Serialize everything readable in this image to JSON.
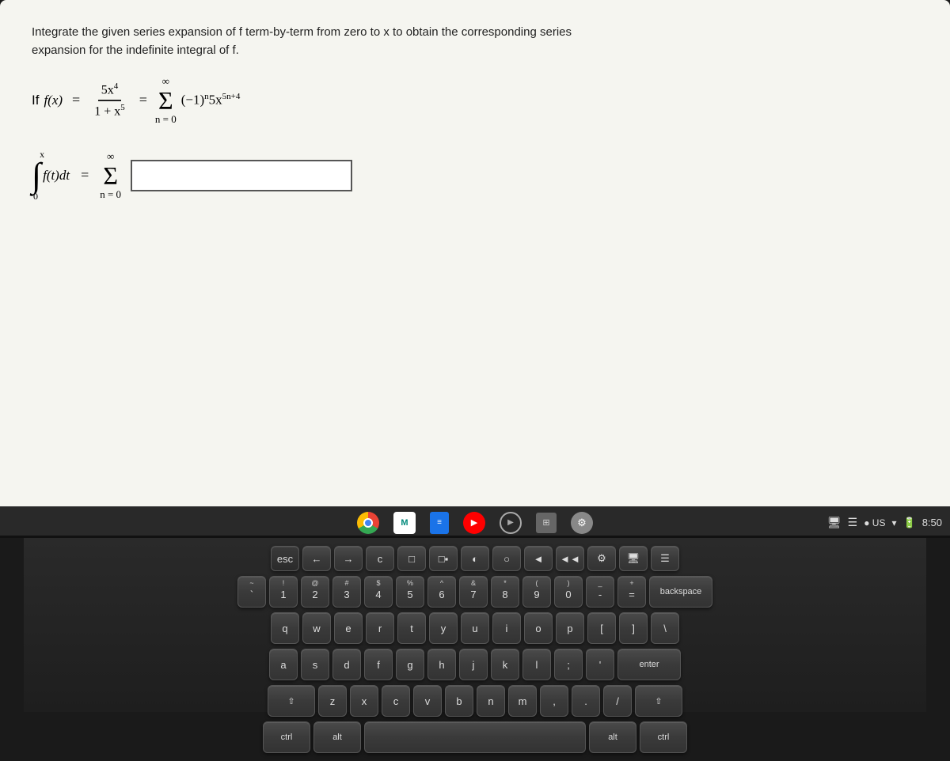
{
  "screen": {
    "problem_line1": "Integrate the given series expansion of  f  term-by-term from zero to  x  to obtain the corresponding series",
    "problem_line2": "expansion for the indefinite integral of  f.",
    "if_label": "If",
    "fx_expr": "f(x) =",
    "fraction_numerator": "5x⁴",
    "fraction_denominator": "1 + x⁵",
    "equals": "=",
    "sigma_limit_top": "∞",
    "sigma_limit_bottom": "n = 0",
    "series_expr": "(− 1)ⁿ5xⁿ⁺ ⁺ ⁴",
    "integral_upper": "x",
    "integral_lower": "0",
    "integral_expr": "f(t)dt =",
    "sigma2_limit_top": "∞",
    "sigma2_limit_bottom": "n = 0",
    "answer_placeholder": ""
  },
  "taskbar": {
    "icons": [
      {
        "name": "chrome",
        "label": "Chrome"
      },
      {
        "name": "meet",
        "label": "M"
      },
      {
        "name": "docs",
        "label": ""
      },
      {
        "name": "youtube",
        "label": "▶"
      },
      {
        "name": "play",
        "label": "▶"
      },
      {
        "name": "photo",
        "label": ""
      },
      {
        "name": "settings",
        "label": "⚙"
      }
    ],
    "right_icons": {
      "screen": "☐",
      "list": "≡",
      "region": "US",
      "wifi": "▾",
      "battery": "🔋",
      "time": "8:50"
    }
  },
  "keyboard": {
    "row1": [
      "esc",
      "←",
      "→",
      "c",
      "□",
      "□□",
      "o",
      "o",
      "◄",
      "▶",
      "⚙",
      "☐",
      "≡"
    ],
    "row2": [
      "`\n1",
      "@\n2",
      "#\n3",
      "$\n4",
      "%\n5",
      "^\n6",
      "&\n7",
      "*\n8",
      "(\n9",
      ")\n0",
      "-",
      "=",
      "backspace"
    ],
    "row3": [
      "q",
      "w",
      "e",
      "r",
      "t",
      "y",
      "u",
      "i",
      "o",
      "p",
      "[",
      "]",
      "\\"
    ],
    "row4": [
      "a",
      "s",
      "d",
      "f",
      "g",
      "h",
      "j",
      "k",
      "l",
      ";",
      "'",
      "enter"
    ],
    "row5": [
      "shift",
      "z",
      "x",
      "c",
      "v",
      "b",
      "n",
      "m",
      ",",
      ".",
      "/",
      "shift"
    ],
    "row6": [
      "ctrl",
      "alt",
      "space",
      "alt",
      "ctrl"
    ]
  }
}
